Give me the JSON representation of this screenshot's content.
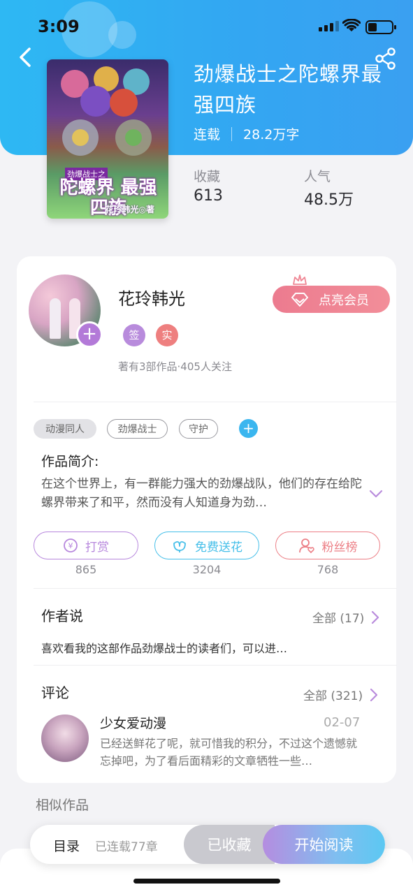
{
  "status_bar": {
    "time": "3:09"
  },
  "book": {
    "title": "劲爆战士之陀螺界最强四族",
    "status": "连载",
    "word_count": "28.2万字",
    "favorites_label": "收藏",
    "favorites_value": "613",
    "popularity_label": "人气",
    "popularity_value": "48.5万",
    "cover_subtitle": "劲爆战士之",
    "cover_title": "陀螺界 最强四族",
    "cover_author": "花玲韩光◎著"
  },
  "author": {
    "name": "花玲韩光",
    "badge_sign": "签",
    "badge_real": "实",
    "stats": "著有3部作品·405人关注",
    "vip_button": "点亮会员"
  },
  "tags": [
    "动漫同人",
    "劲爆战士",
    "守护"
  ],
  "intro": {
    "heading": "作品简介:",
    "text": "在这个世界上，有一群能力强大的劲爆战队，他们的存在给陀螺界带来了和平，然而没有人知道身为劲…"
  },
  "actions": [
    {
      "label": "打赏",
      "count": "865"
    },
    {
      "label": "免费送花",
      "count": "3204"
    },
    {
      "label": "粉丝榜",
      "count": "768"
    }
  ],
  "author_says": {
    "heading": "作者说",
    "link": "全部 (17)",
    "text": "喜欢看我的这部作品劲爆战士的读者们，可以进…"
  },
  "comments": {
    "heading": "评论",
    "link": "全部 (321)",
    "item": {
      "user": "少女爱动漫",
      "date": "02-07",
      "text": "已经送鲜花了呢，就可惜我的积分，不过这个遗憾就忘掉吧，为了看后面精彩的文章牺牲一些…"
    }
  },
  "similar": {
    "heading": "相似作品"
  },
  "bottom_bar": {
    "toc": "目录",
    "serial": "已连载77章",
    "collected": "已收藏",
    "start_reading": "开始阅读"
  },
  "colors": {
    "hero": "#33a6f2",
    "reward": "#b787dd",
    "flower": "#46bfe9",
    "fans": "#ec7f86",
    "vip": "#ef8593"
  }
}
